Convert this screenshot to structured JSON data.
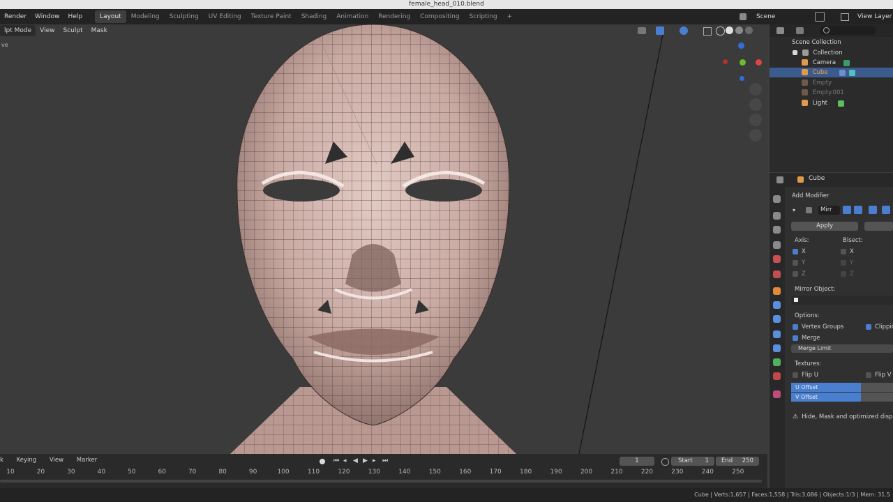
{
  "window": {
    "title": "female_head_010.blend"
  },
  "menu": {
    "items": [
      "Render",
      "Window",
      "Help"
    ]
  },
  "workspaces": [
    "Layout",
    "Modeling",
    "Sculpting",
    "UV Editing",
    "Texture Paint",
    "Shading",
    "Animation",
    "Rendering",
    "Compositing",
    "Scripting"
  ],
  "workspace_add": "+",
  "top_right": {
    "scene": "Scene",
    "view_layer": "View Layer"
  },
  "viewport_header": {
    "mode": "lpt Mode",
    "items": [
      "View",
      "Sculpt",
      "Mask"
    ],
    "corner_text": "ve"
  },
  "outliner": {
    "rows": [
      {
        "label": "Scene Collection",
        "style": "normal"
      },
      {
        "label": "Collection",
        "style": "normal"
      },
      {
        "label": "Camera",
        "style": "normal"
      },
      {
        "label": "Cube",
        "style": "sel"
      },
      {
        "label": "Empty",
        "style": "dim"
      },
      {
        "label": "Empty.001",
        "style": "dim"
      },
      {
        "label": "Light",
        "style": "normal"
      }
    ]
  },
  "properties": {
    "object_name": "Cube",
    "add_modifier": "Add Modifier",
    "modifier_name": "Mirr",
    "apply": "Apply",
    "axis_label": "Axis:",
    "bisect_label": "Bisect:",
    "axis_items": [
      "X",
      "Y",
      "Z"
    ],
    "bisect_items": [
      "X",
      "Y",
      "Z"
    ],
    "mirror_object_label": "Mirror Object:",
    "options_label": "Options:",
    "vertex_groups": "Vertex Groups",
    "clipping": "Clippin",
    "merge": "Merge",
    "merge_limit": "Merge Limit",
    "textures_label": "Textures:",
    "flip_u": "Flip U",
    "flip_v": "Flip V",
    "u_offset": "U Offset",
    "v_offset": "V Offset",
    "warning": "Hide, Mask and optimized display d"
  },
  "timeline": {
    "menu": [
      "k",
      "Keying",
      "View",
      "Marker"
    ],
    "current_frame": "1",
    "start_label": "Start",
    "start": "1",
    "end_label": "End",
    "end": "250",
    "ticks": [
      "10",
      "20",
      "30",
      "40",
      "50",
      "60",
      "70",
      "80",
      "90",
      "100",
      "110",
      "120",
      "130",
      "140",
      "150",
      "160",
      "170",
      "180",
      "190",
      "200",
      "210",
      "220",
      "230",
      "240",
      "250"
    ]
  },
  "status": {
    "text": "Cube | Verts:1,657 | Faces:1,558 | Tris:3,086 | Objects:1/3 | Mem: 31.5"
  },
  "colors": {
    "accent": "#4a7fd0",
    "mesh": "#c9aaa3",
    "header": "#232323"
  }
}
